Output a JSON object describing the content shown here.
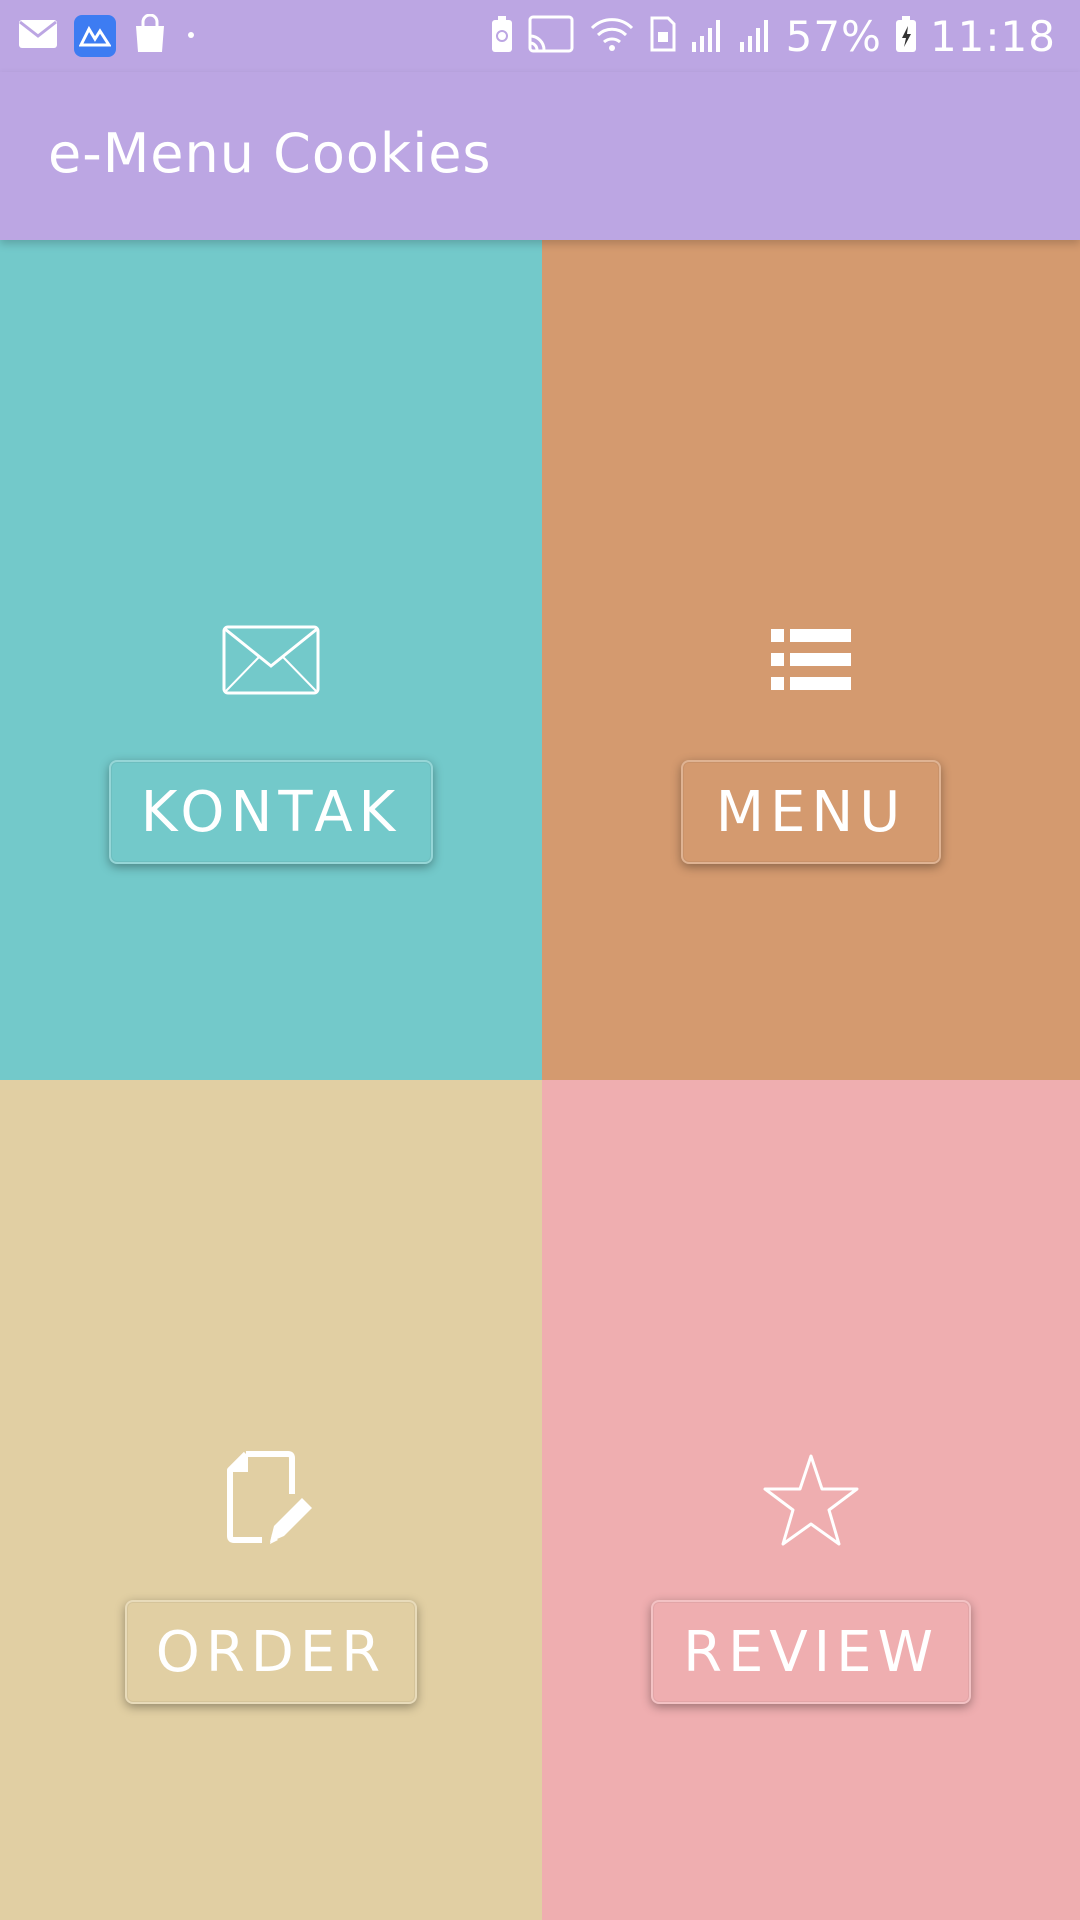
{
  "status_bar": {
    "battery": "57%",
    "time": "11:18",
    "left_icons": [
      "gmail-icon",
      "app-icon",
      "shopping-bag-icon",
      "dot-icon"
    ],
    "right_icons": [
      "battery-saver-icon",
      "cast-icon",
      "wifi-icon",
      "sim-icon",
      "signal-icon",
      "signal-icon",
      "battery-charging-icon"
    ]
  },
  "app_bar": {
    "title": "e-Menu Cookies"
  },
  "tiles": [
    {
      "label": "KONTAK",
      "icon": "mail-icon",
      "color": "#73c9ca"
    },
    {
      "label": "MENU",
      "icon": "list-icon",
      "color": "#d49a6f"
    },
    {
      "label": "ORDER",
      "icon": "edit-document-icon",
      "color": "#e1cfa3"
    },
    {
      "label": "REVIEW",
      "icon": "star-icon",
      "color": "#efaeb0"
    }
  ],
  "colors": {
    "app_bar": "#bca6e3",
    "text": "#ffffff"
  }
}
